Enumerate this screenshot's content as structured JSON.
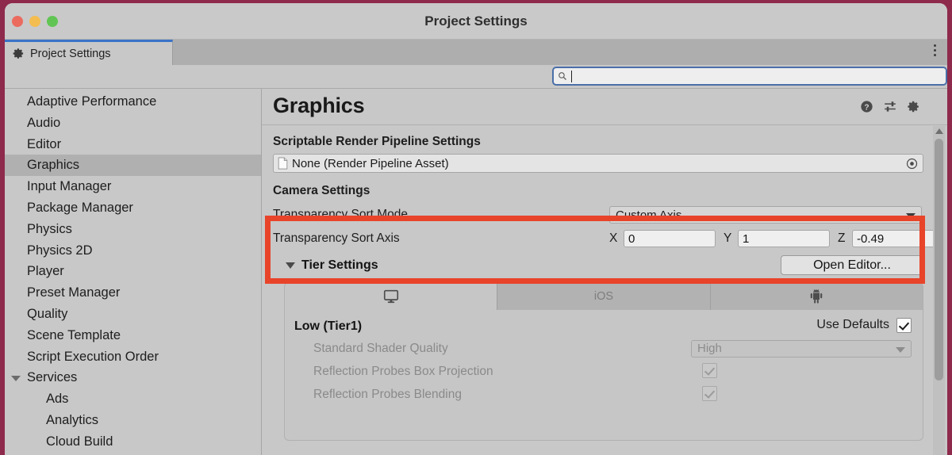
{
  "window": {
    "title": "Project Settings",
    "traffic_lights": [
      "close",
      "minimize",
      "zoom"
    ]
  },
  "tabbar": {
    "tab_label": "Project Settings",
    "tab_icon": "gear-icon",
    "overflow_menu": "kebab-menu-icon"
  },
  "search": {
    "value": "",
    "placeholder": "",
    "icon": "search-icon"
  },
  "sidebar": {
    "items": [
      {
        "label": "Adaptive Performance",
        "selected": false,
        "child": false,
        "expandable": false
      },
      {
        "label": "Audio",
        "selected": false,
        "child": false,
        "expandable": false
      },
      {
        "label": "Editor",
        "selected": false,
        "child": false,
        "expandable": false
      },
      {
        "label": "Graphics",
        "selected": true,
        "child": false,
        "expandable": false
      },
      {
        "label": "Input Manager",
        "selected": false,
        "child": false,
        "expandable": false
      },
      {
        "label": "Package Manager",
        "selected": false,
        "child": false,
        "expandable": false
      },
      {
        "label": "Physics",
        "selected": false,
        "child": false,
        "expandable": false
      },
      {
        "label": "Physics 2D",
        "selected": false,
        "child": false,
        "expandable": false
      },
      {
        "label": "Player",
        "selected": false,
        "child": false,
        "expandable": false
      },
      {
        "label": "Preset Manager",
        "selected": false,
        "child": false,
        "expandable": false
      },
      {
        "label": "Quality",
        "selected": false,
        "child": false,
        "expandable": false
      },
      {
        "label": "Scene Template",
        "selected": false,
        "child": false,
        "expandable": false
      },
      {
        "label": "Script Execution Order",
        "selected": false,
        "child": false,
        "expandable": false
      },
      {
        "label": "Services",
        "selected": false,
        "child": false,
        "expandable": true
      },
      {
        "label": "Ads",
        "selected": false,
        "child": true,
        "expandable": false
      },
      {
        "label": "Analytics",
        "selected": false,
        "child": true,
        "expandable": false
      },
      {
        "label": "Cloud Build",
        "selected": false,
        "child": true,
        "expandable": false
      }
    ]
  },
  "panel": {
    "title": "Graphics",
    "header_icons": [
      "help-icon",
      "preset-icon",
      "gear-icon"
    ],
    "srp": {
      "section_label": "Scriptable Render Pipeline Settings",
      "asset_value": "None (Render Pipeline Asset)",
      "asset_icon": "document-icon",
      "picker_icon": "object-picker-icon"
    },
    "camera": {
      "section_label": "Camera Settings",
      "sort_mode_label": "Transparency Sort Mode",
      "sort_mode_value": "Custom Axis",
      "sort_axis_label": "Transparency Sort Axis",
      "axis_x_label": "X",
      "axis_x_value": "0",
      "axis_y_label": "Y",
      "axis_y_value": "1",
      "axis_z_label": "Z",
      "axis_z_value": "-0.49"
    },
    "tier": {
      "foldout_label": "Tier Settings",
      "open_editor_label": "Open Editor...",
      "platform_tabs": [
        {
          "label": "",
          "icon": "desktop-monitor-icon",
          "active": true
        },
        {
          "label": "iOS",
          "icon": "",
          "active": false
        },
        {
          "label": "",
          "icon": "android-robot-icon",
          "active": false
        }
      ],
      "tier_name": "Low (Tier1)",
      "use_defaults_label": "Use Defaults",
      "use_defaults_checked": true,
      "rows": [
        {
          "label": "Standard Shader Quality",
          "type": "dropdown",
          "value": "High",
          "disabled": true
        },
        {
          "label": "Reflection Probes Box Projection",
          "type": "checkbox",
          "checked": true,
          "disabled": true
        },
        {
          "label": "Reflection Probes Blending",
          "type": "checkbox",
          "checked": true,
          "disabled": true
        }
      ]
    }
  },
  "annotation": {
    "highlight_color": "#e8442a",
    "target": "Camera Settings transparency sort fields"
  },
  "scrollbar": {
    "up_arrow": "scroll-up-arrow-icon"
  }
}
